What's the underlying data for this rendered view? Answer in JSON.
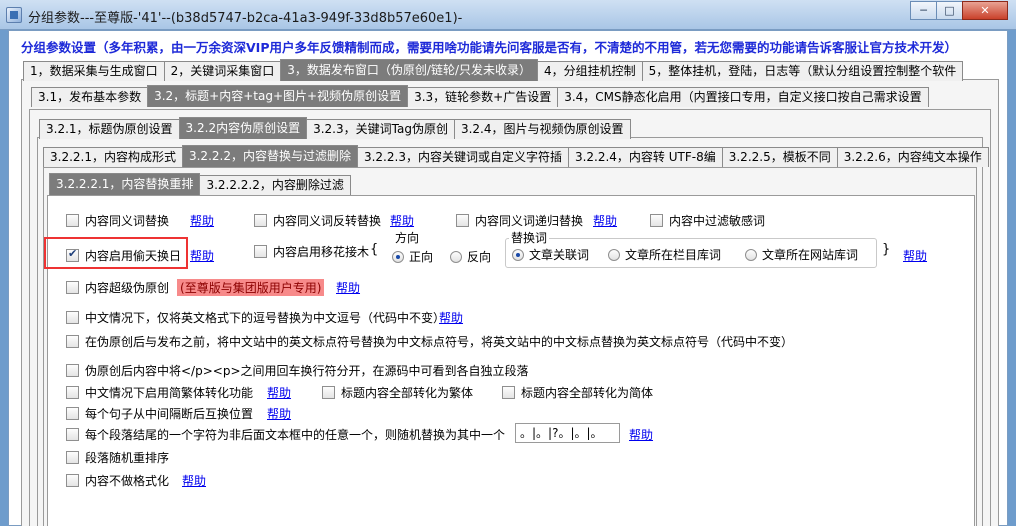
{
  "titlebar": {
    "title": "分组参数---至尊版-'41'--(b38d5747-b2ca-41a3-949f-33d8b57e60e1)-",
    "minimize": "─",
    "maximize": "□",
    "close": "✕"
  },
  "banner": "分组参数设置（多年积累，由一万余资深VIP用户多年反馈精制而成，需要用啥功能请先问客服是否有，不清楚的不用管，若无您需要的功能请告诉客服让官方技术开发）",
  "tabs1": [
    "1，数据采集与生成窗口",
    "2，关键词采集窗口",
    "3，数据发布窗口（伪原创/链轮/只发未收录）",
    "4，分组挂机控制",
    "5，整体挂机，登陆，日志等（默认分组设置控制整个软件"
  ],
  "tabs2": [
    "3.1，发布基本参数",
    "3.2，标题+内容+tag+图片+视频伪原创设置",
    "3.3，链轮参数+广告设置",
    "3.4，CMS静态化启用（内置接口专用，自定义接口按自己需求设置"
  ],
  "tabs3": [
    "3.2.1，标题伪原创设置",
    "3.2.2内容伪原创设置",
    "3.2.3，关键词Tag伪原创",
    "3.2.4，图片与视频伪原创设置"
  ],
  "tabs4": [
    "3.2.2.1，内容构成形式",
    "3.2.2.2，内容替换与过滤删除",
    "3.2.2.3，内容关键词或自定义字符插",
    "3.2.2.4，内容转 UTF-8编",
    "3.2.2.5，模板不同",
    "3.2.2.6，内容纯文本操作"
  ],
  "tabs5": [
    "3.2.2.2.1，内容替换重排",
    "3.2.2.2.2，内容删除过滤"
  ],
  "help": "帮助",
  "options": {
    "synonym": "内容同义词替换",
    "antonym": "内容同义词反转替换",
    "recursive": "内容同义词递归替换",
    "sensitive": "内容中过滤敏感词",
    "steal": "内容启用偷天换日",
    "graft": "内容启用移花接木",
    "graft_brace_open": "{",
    "graft_brace_close": "}",
    "super": "内容超级伪原创",
    "super_warn": "(至尊版与集团版用户专用)",
    "comma": "中文情况下，仅将英文格式下的逗号替换为中文逗号（代码中不变）",
    "punct": "在伪原创后与发布之前，将中文站中的英文标点符号替换为中文标点符号，将英文站中的中文标点替换为英文标点符号（代码中不变）",
    "para": "伪原创后内容中将</p><p>之间用回车换行符分开，在源码中可看到各自独立段落",
    "trad": "中文情况下启用简繁体转化功能",
    "title_trad": "标题内容全部转化为繁体",
    "title_simp": "标题内容全部转化为简体",
    "swap": "每个句子从中间隔断后互换位置",
    "lastchar": "每个段落结尾的一个字符为非后面文本框中的任意一个，则随机替换为其中一个",
    "lastchar_value": "。|。|?。|。|。",
    "shuffle": "段落随机重排序",
    "noformat": "内容不做格式化"
  },
  "direction": {
    "label": "方向",
    "forward": "正向",
    "reverse": "反向"
  },
  "replace_words": {
    "label": "替换词",
    "opt1": "文章关联词",
    "opt2": "文章所在栏目库词",
    "opt3": "文章所在网站库词"
  }
}
